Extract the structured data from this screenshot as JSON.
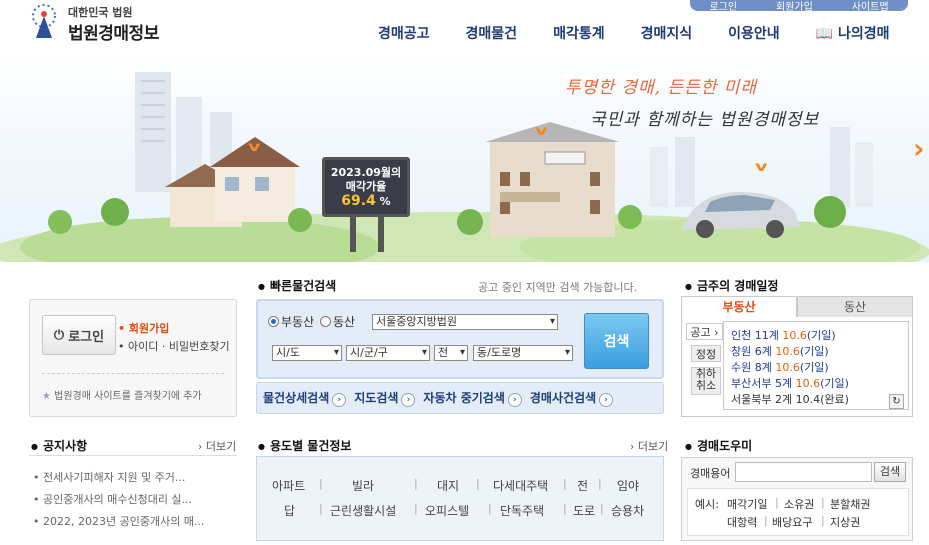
{
  "util": [
    "로그인",
    "회원가입",
    "사이트맵"
  ],
  "logo": {
    "top": "대한민국 법원",
    "main": "법원경매정보"
  },
  "gnb": [
    "경매공고",
    "경매물건",
    "매각통계",
    "경매지식",
    "이용안내",
    "나의경매"
  ],
  "hero": {
    "slogan1": "투명한 경매, 든든한 미래",
    "slogan2": "국민과 함께하는 법원경매정보",
    "billboard_line1": "2023.09월의",
    "billboard_line2": "매각가율",
    "billboard_pct": "69.4",
    "billboard_unit": "%"
  },
  "login": {
    "button": "로그인",
    "signup": "회원가입",
    "find": "아이디 · 비밀번호찾기",
    "favorite": "법원경매 사이트를 즐겨찾기에 추가"
  },
  "notice": {
    "title": "공지사항",
    "more": "더보기",
    "items": [
      "전세사기피해자 지원 및 주거...",
      "공인중개사의 매수신청대리 실...",
      "2022, 2023년 공인중개사의 매..."
    ]
  },
  "quick": {
    "title": "빠른물건검색",
    "hint": "공고 중인 지역만 검색 가능합니다.",
    "radio1": "부동산",
    "radio2": "동산",
    "court": "서울중앙지방법원",
    "sido": "시/도",
    "sigungu": "시/군/구",
    "jeon": "전",
    "dong": "동/도로명",
    "search": "검색",
    "links": [
      "물건상세검색",
      "지도검색",
      "자동차 중기검색",
      "경매사건검색"
    ]
  },
  "usage": {
    "title": "용도별 물건정보",
    "more": "더보기",
    "row1": [
      "아파트",
      "빌라",
      "대지",
      "다세대주택",
      "전",
      "임야"
    ],
    "row2": [
      "답",
      "근린생활시설",
      "오피스텔",
      "단독주택",
      "도로",
      "승용차"
    ]
  },
  "schedule": {
    "title": "금주의 경매일정",
    "tab_on": "부동산",
    "tab_off": "동산",
    "side": [
      "공고",
      "정정",
      "취하",
      "취소"
    ],
    "rows": [
      {
        "name": "인천 11계",
        "date": "10.6",
        "note": "(기일)"
      },
      {
        "name": "창원 6계",
        "date": "10.6",
        "note": "(기일)"
      },
      {
        "name": "수원 8계",
        "date": "10.6",
        "note": "(기일)"
      },
      {
        "name": "부산서부 5계",
        "date": "10.6",
        "note": "(기일)"
      },
      {
        "name": "서울북부 2계",
        "date": "10.4",
        "note": "(완료)"
      }
    ]
  },
  "helper": {
    "title": "경매도우미",
    "label": "경매용어",
    "button": "검색",
    "example_label": "예시:",
    "examples": [
      "매각기일",
      "소유권",
      "분할채권",
      "대항력",
      "배당요구",
      "지상권"
    ]
  },
  "colors": {
    "nav": "#1e3a78",
    "accent": "#e04b10",
    "panel": "#e3ecf7"
  }
}
